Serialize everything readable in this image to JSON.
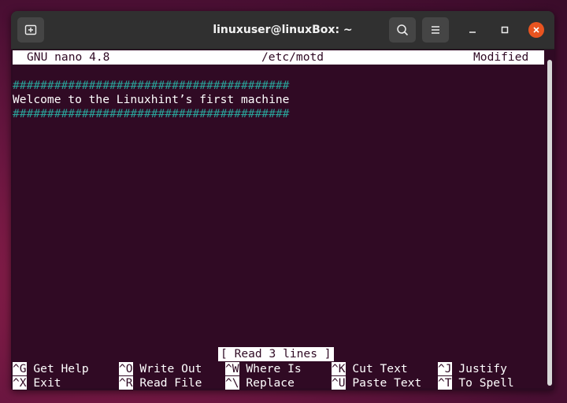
{
  "window": {
    "title": "linuxuser@linuxBox: ~"
  },
  "icons": {
    "new_tab": "new-tab-icon",
    "search": "search-icon",
    "menu": "hamburger-menu-icon",
    "minimize": "minimize-icon",
    "maximize": "maximize-icon",
    "close": "close-icon"
  },
  "nano": {
    "version": "GNU nano 4.8",
    "filename": "/etc/motd",
    "state": "Modified",
    "lines": [
      "########################################",
      "Welcome to the Linuxhint’s first machine",
      "########################################"
    ],
    "status_message": "[ Read 3 lines ]",
    "shortcuts_row1": [
      {
        "key": "^G",
        "label": "Get Help"
      },
      {
        "key": "^O",
        "label": "Write Out"
      },
      {
        "key": "^W",
        "label": "Where Is"
      },
      {
        "key": "^K",
        "label": "Cut Text"
      },
      {
        "key": "^J",
        "label": "Justify"
      }
    ],
    "shortcuts_row2": [
      {
        "key": "^X",
        "label": "Exit"
      },
      {
        "key": "^R",
        "label": "Read File"
      },
      {
        "key": "^\\",
        "label": "Replace"
      },
      {
        "key": "^U",
        "label": "Paste Text"
      },
      {
        "key": "^T",
        "label": "To Spell"
      }
    ]
  },
  "colors": {
    "terminal_bg": "#300a24",
    "hash_color": "#2aa198",
    "close_button": "#e95420"
  }
}
